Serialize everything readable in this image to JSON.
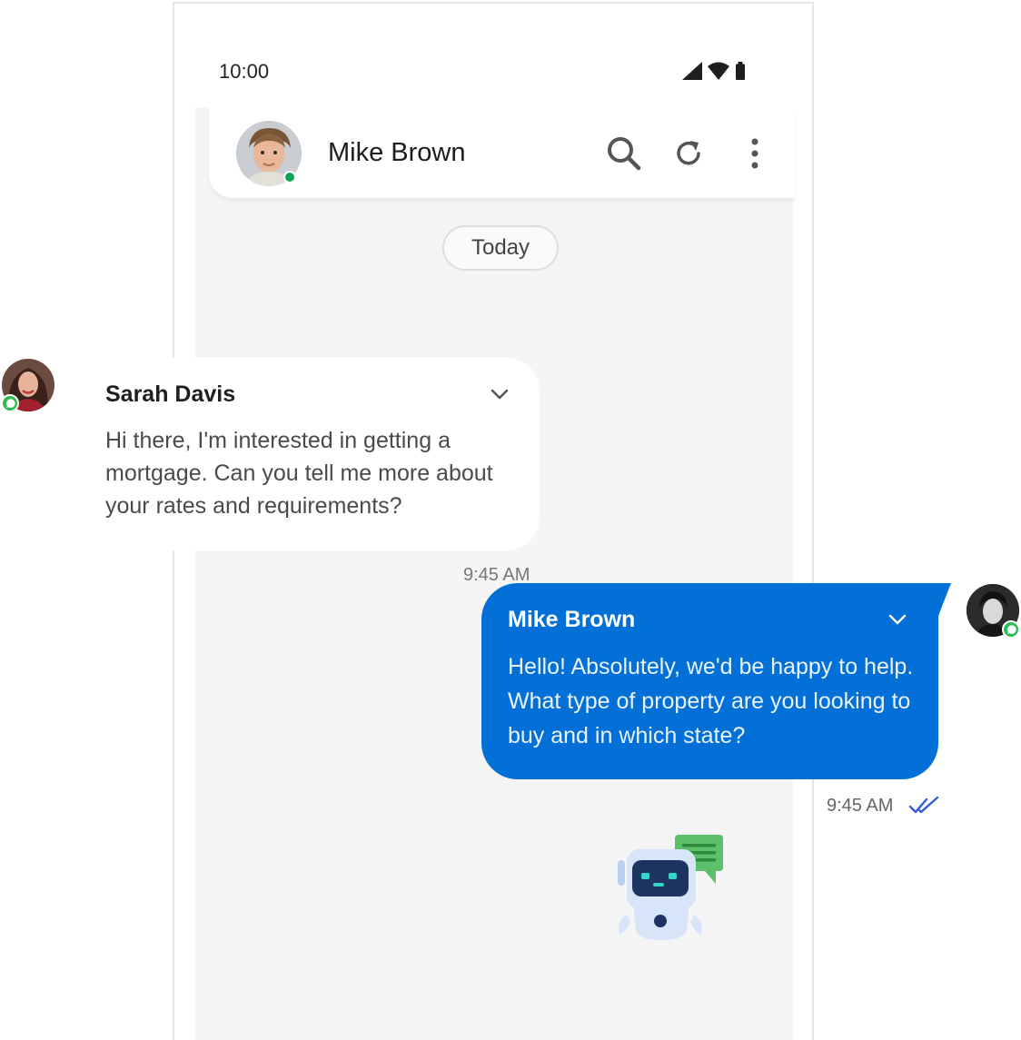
{
  "status_bar": {
    "time": "10:00",
    "icons": [
      "signal-icon",
      "wifi-icon",
      "battery-icon"
    ]
  },
  "chat_header": {
    "contact_name": "Mike Brown",
    "online": true,
    "actions": [
      "search-icon",
      "refresh-icon",
      "more-vertical-icon"
    ]
  },
  "date_separator": "Today",
  "messages": [
    {
      "sender": "Sarah Davis",
      "text": "Hi there, I'm interested in getting a mortgage. Can you tell me more about your rates and requirements?",
      "time": "9:45 AM",
      "direction": "incoming",
      "channel": "whatsapp"
    },
    {
      "sender": "Mike Brown",
      "text": "Hello! Absolutely, we'd be happy to help. What type of property are you looking to buy and in which state?",
      "time": "9:45 AM",
      "direction": "outgoing",
      "channel": "whatsapp",
      "status": "read"
    }
  ],
  "colors": {
    "outgoing_bubble": "#0270d7",
    "incoming_bubble": "#ffffff",
    "chat_background": "#f5f5f5",
    "online_dot": "#10a35b",
    "whatsapp_badge": "#2dbb54",
    "read_ticks": "#3b5bdb"
  }
}
